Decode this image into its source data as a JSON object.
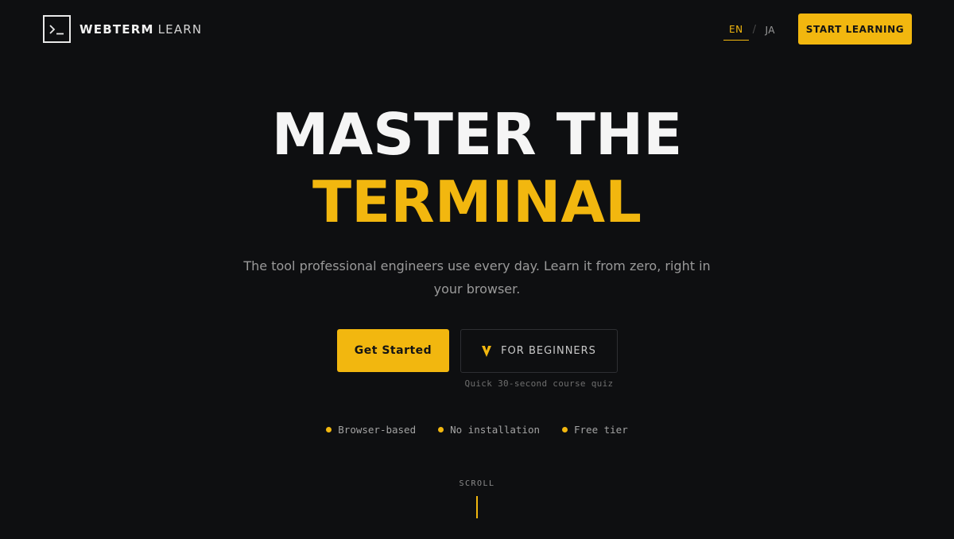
{
  "header": {
    "logo_icon": "terminal-prompt-icon",
    "logo_strong": "WEBTERM",
    "logo_light": "LEARN",
    "lang_en": "EN",
    "lang_sep": "/",
    "lang_ja": "JA",
    "start_label": "START LEARNING"
  },
  "hero": {
    "title_line1": "MASTER THE",
    "title_line2": "TERMINAL",
    "subtitle": "The tool professional engineers use every day. Learn it from zero, right in your browser.",
    "primary_button": "Get Started",
    "secondary_button": "FOR BEGINNERS",
    "secondary_icon": "v-chevron-icon",
    "quiz_caption": "Quick 30-second course quiz"
  },
  "features": [
    {
      "label": "Browser-based"
    },
    {
      "label": "No installation"
    },
    {
      "label": "Free tier"
    }
  ],
  "scroll": {
    "label": "SCROLL"
  },
  "colors": {
    "background": "#0e0f11",
    "accent": "#f2b70f",
    "text_primary": "#f5f5f5",
    "text_muted": "#9a9a9a"
  }
}
